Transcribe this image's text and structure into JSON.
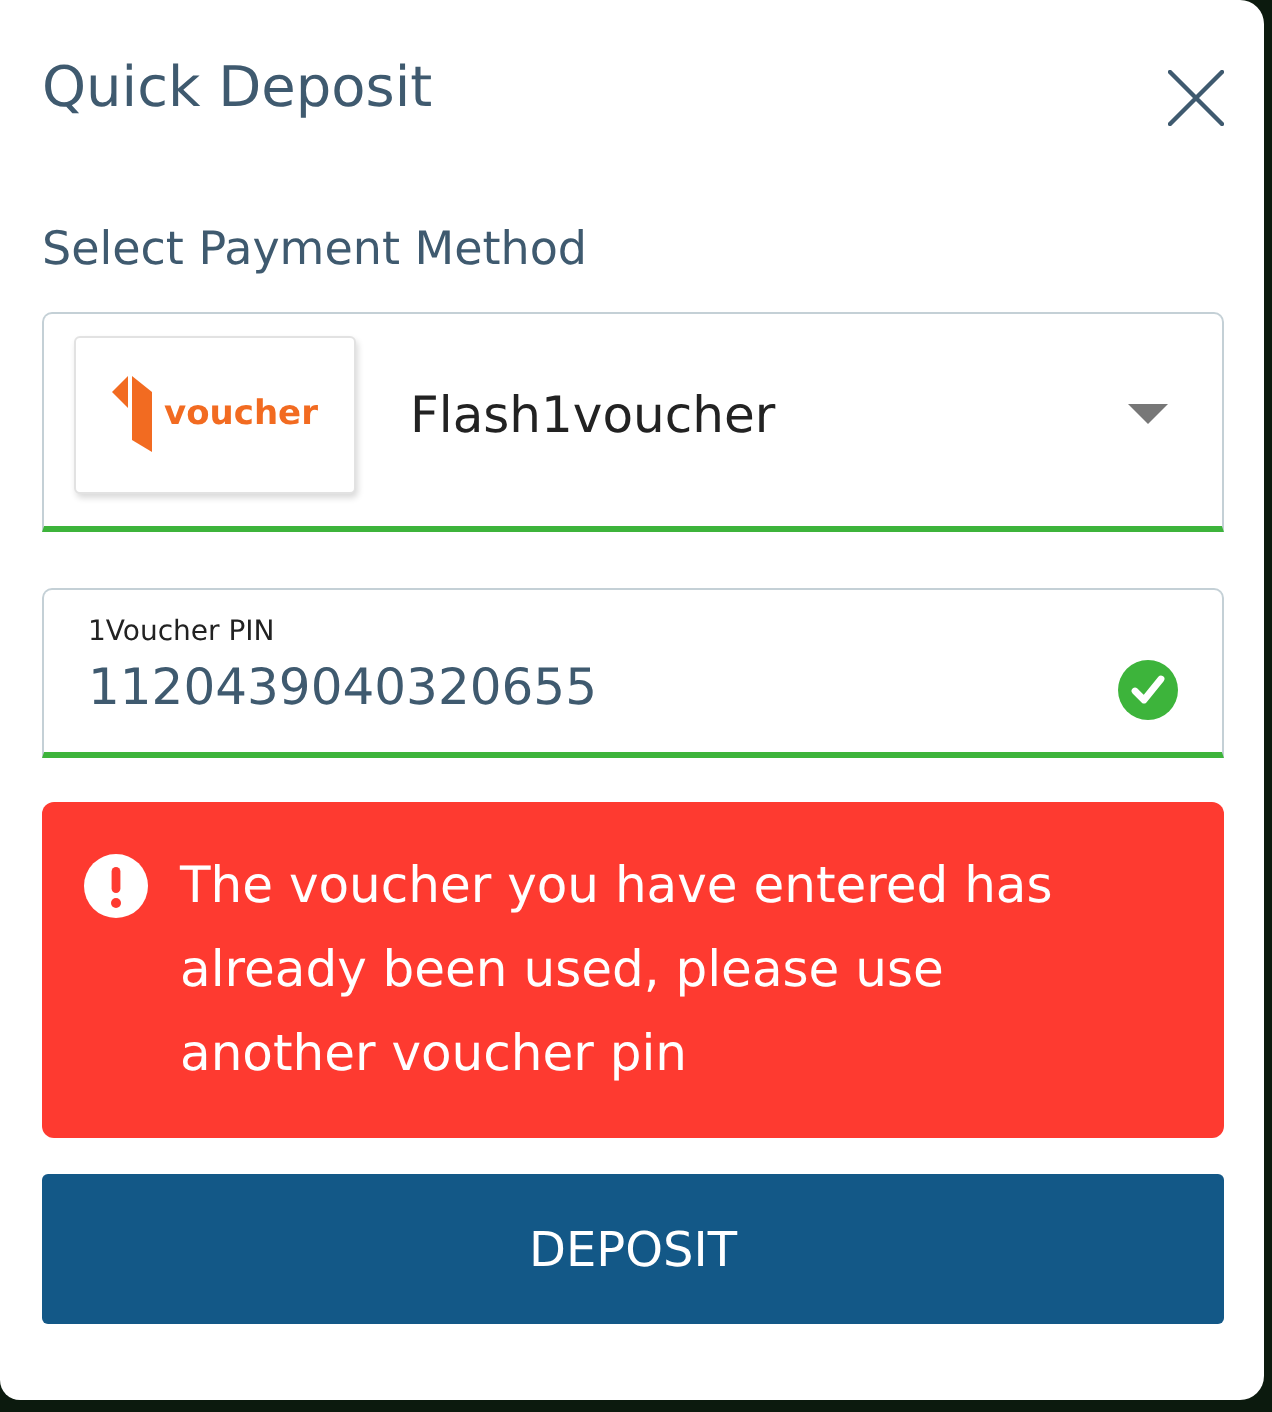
{
  "dialog": {
    "title": "Quick Deposit"
  },
  "payment_method": {
    "label": "Select Payment Method",
    "logo_text": "voucher",
    "selected_method": "Flash1voucher",
    "valid": true
  },
  "pin_field": {
    "label": "1Voucher PIN",
    "value": "1120439040320655",
    "valid": true
  },
  "alert": {
    "kind": "error",
    "message": "The voucher you have entered has already been used, please use another voucher pin"
  },
  "buttons": [
    {
      "label": "DEPOSIT"
    }
  ]
}
